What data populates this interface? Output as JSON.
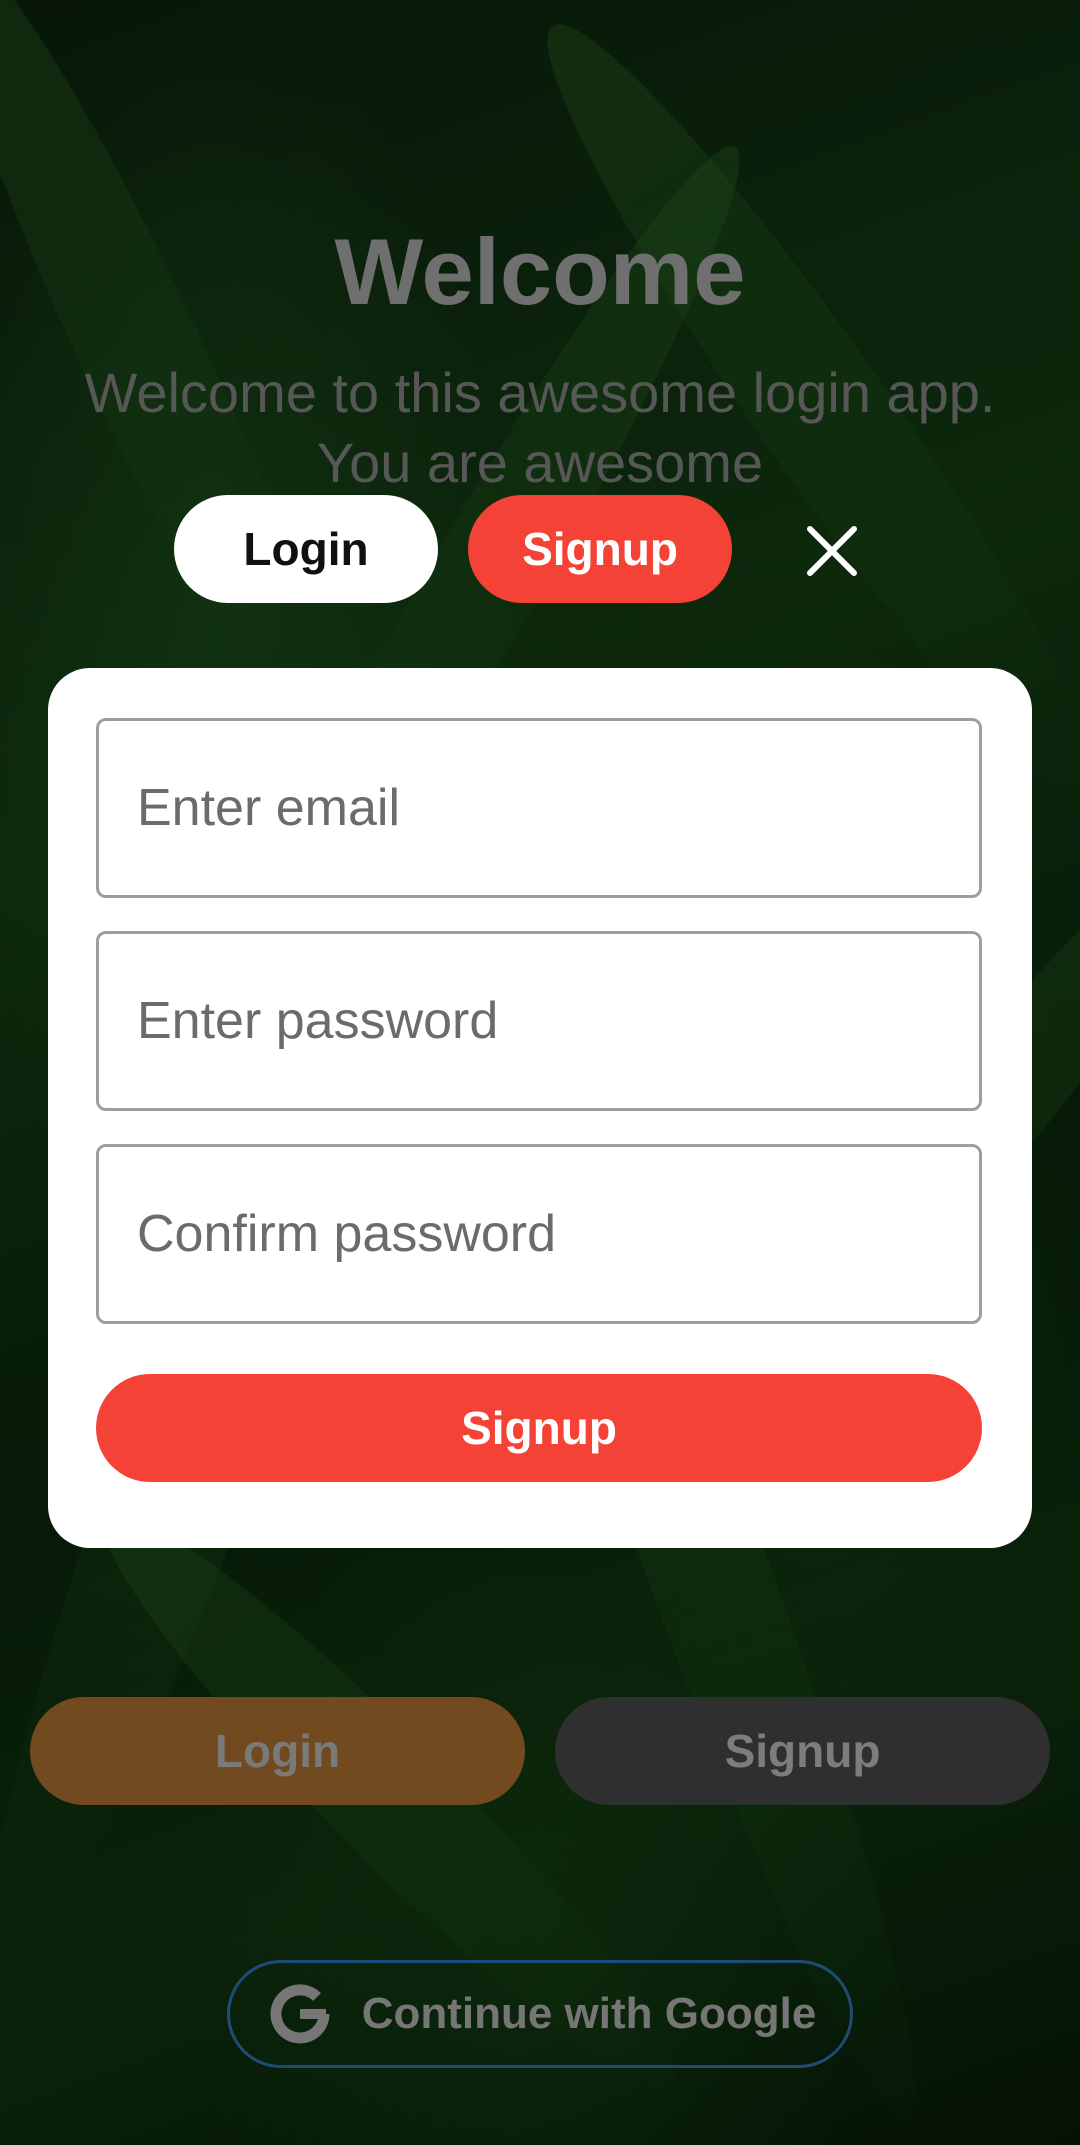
{
  "welcome": {
    "title": "Welcome",
    "subtitle": "Welcome to this awesome login app. You are awesome"
  },
  "tabs": {
    "login_label": "Login",
    "signup_label": "Signup",
    "active": "signup"
  },
  "form": {
    "email_placeholder": "Enter email",
    "password_placeholder": "Enter password",
    "confirm_placeholder": "Confirm password",
    "submit_label": "Signup"
  },
  "background_actions": {
    "login_label": "Login",
    "signup_label": "Signup",
    "google_label": "Continue with Google"
  },
  "icons": {
    "close": "close-icon",
    "google": "google-g-icon"
  },
  "colors": {
    "accent": "#f44336",
    "login_bg": "#714a20",
    "signup_bg": "#2f2f2f",
    "google_border": "#1f4a7a"
  }
}
